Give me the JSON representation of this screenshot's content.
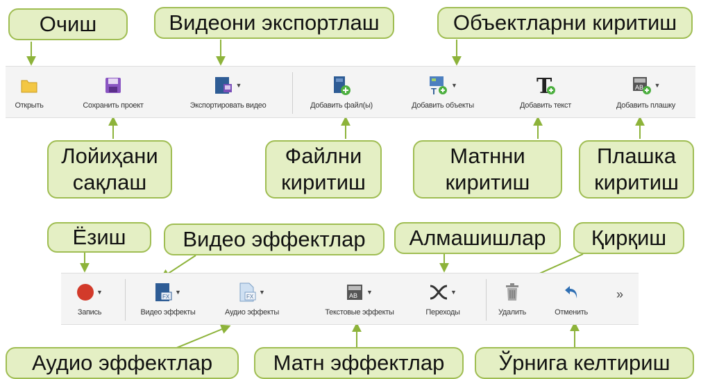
{
  "callouts": {
    "open": "Очиш",
    "export_video": "Видеони экспортлаш",
    "add_objects": "Объектларни киритиш",
    "save_project": [
      "Лойиҳани",
      "сақлаш"
    ],
    "add_files": [
      "Файлни",
      "киритиш"
    ],
    "add_text": [
      "Матнни",
      "киритиш"
    ],
    "add_plate": [
      "Плашка",
      "киритиш"
    ],
    "record": "Ёзиш",
    "video_effects": "Видео эффектлар",
    "transitions": "Алмашишлар",
    "cut": "Қирқиш",
    "audio_effects": "Аудио эффектлар",
    "text_effects": "Матн эффектлар",
    "undo": "Ўрнига келтириш"
  },
  "toolbar1": {
    "buttons": [
      {
        "label": "Открыть",
        "icon": "folder-icon"
      },
      {
        "label": "Сохранить проект",
        "icon": "floppy-disk-icon"
      },
      {
        "label": "Экспортировать видео",
        "icon": "export-video-icon"
      },
      {
        "label": "Добавить файл(ы)",
        "icon": "add-file-icon"
      },
      {
        "label": "Добавить объекты",
        "icon": "add-objects-icon"
      },
      {
        "label": "Добавить текст",
        "icon": "add-text-icon"
      },
      {
        "label": "Добавить плашку",
        "icon": "add-plate-icon"
      }
    ]
  },
  "toolbar2": {
    "buttons": [
      {
        "label": "Запись",
        "icon": "record-icon"
      },
      {
        "label": "Видео эффекты",
        "icon": "video-effects-icon"
      },
      {
        "label": "Аудио эффекты",
        "icon": "audio-effects-icon"
      },
      {
        "label": "Текстовые эффекты",
        "icon": "text-effects-icon"
      },
      {
        "label": "Переходы",
        "icon": "transitions-icon"
      },
      {
        "label": "Удалить",
        "icon": "trash-icon"
      },
      {
        "label": "Отменить",
        "icon": "undo-icon"
      }
    ],
    "more_glyph": "»"
  },
  "colors": {
    "callout_fill": "#e4efc4",
    "callout_border": "#9fbd52",
    "arrow": "#8db33a",
    "folder": "#f3c744",
    "save": "#8a55c2",
    "film": "#2e5c95",
    "green_plus": "#4caf3f",
    "record": "#d23a2a",
    "undo": "#2f6fb3"
  }
}
